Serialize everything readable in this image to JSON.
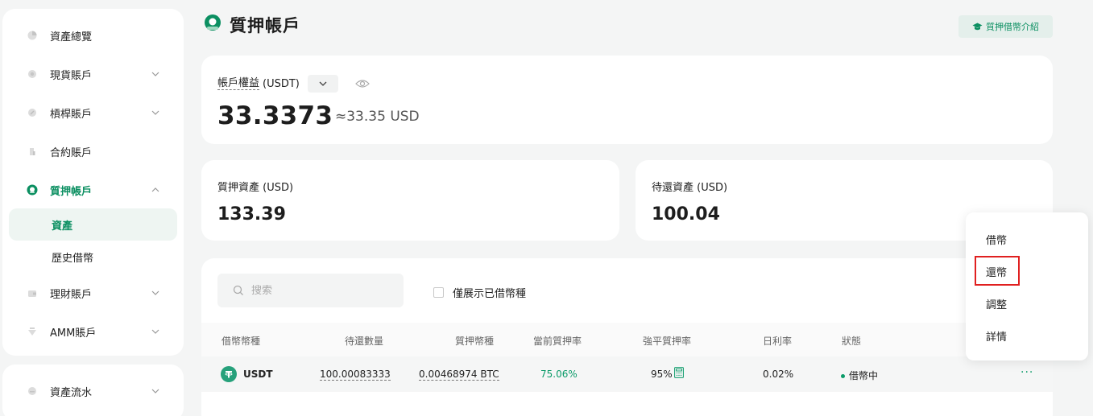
{
  "sidebar": {
    "items": [
      {
        "label": "資產總覽"
      },
      {
        "label": "現貨賬戶"
      },
      {
        "label": "槓桿賬戶"
      },
      {
        "label": "合約賬戶"
      },
      {
        "label": "質押帳戶"
      },
      {
        "label": "理財賬戶"
      },
      {
        "label": "AMM賬戶"
      }
    ],
    "sub_items": [
      {
        "label": "資產"
      },
      {
        "label": "歷史借幣"
      }
    ],
    "bottom_item": {
      "label": "資產流水"
    }
  },
  "header": {
    "title": "質押帳戶",
    "intro_button": "質押借幣介紹"
  },
  "equity": {
    "label": "帳戶權益",
    "unit": "(USDT)",
    "value": "33.3373",
    "approx": "≈33.35 USD"
  },
  "collateral": {
    "label": "質押資產 (USD)",
    "value": "133.39"
  },
  "repay": {
    "label": "待還資產 (USD)",
    "value": "100.04"
  },
  "table": {
    "search_placeholder": "搜索",
    "only_borrowed_label": "僅展示已借幣種",
    "headers": [
      "借幣幣種",
      "待還數量",
      "質押幣種",
      "當前質押率",
      "強平質押率",
      "日利率",
      "狀態"
    ],
    "rows": [
      {
        "coin": "USDT",
        "repay_amount": "100.00083333",
        "collateral": "0.00468974 BTC",
        "current_ratio": "75.06%",
        "liquidation_ratio": "95%",
        "daily_rate": "0.02%",
        "status": "借幣中",
        "more": "···"
      }
    ]
  },
  "dropdown": {
    "items": [
      "借幣",
      "還幣",
      "調整",
      "詳情"
    ]
  },
  "colors": {
    "accent": "#0b8f61",
    "tether": "#26a17b",
    "highlight": "#e02020"
  }
}
